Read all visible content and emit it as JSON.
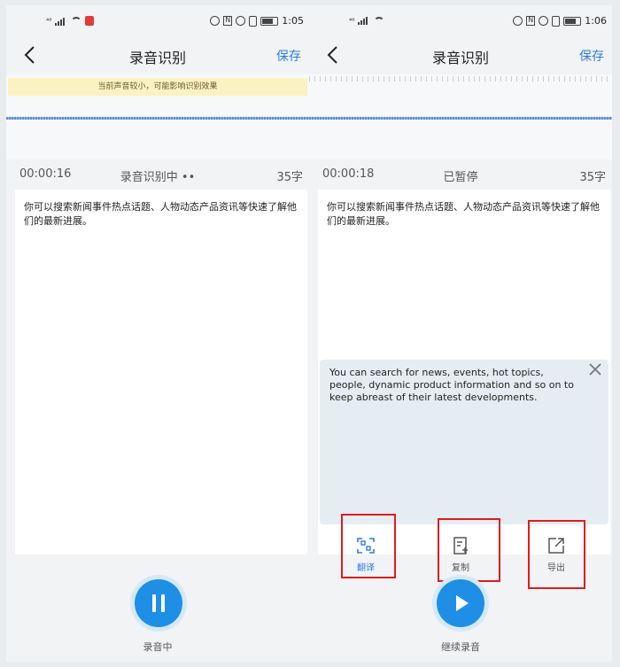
{
  "colors": {
    "accent": "#2a7de1",
    "button": "#1f8fe6",
    "highlight_box": "#e01c1c",
    "notice_bg": "#fbf2c2"
  },
  "left": {
    "status": {
      "time": "1:05",
      "carrier_label": "⁴⁶"
    },
    "nav": {
      "title": "录音识别",
      "save": "保存"
    },
    "notice": "当前声音较小，可能影响识别效果",
    "info": {
      "elapsed": "00:00:16",
      "state": "录音识别中 ••",
      "count": "35字"
    },
    "transcript": "你可以搜索新闻事件热点话题、人物动态产品资讯等快速了解他们的最新进展。",
    "bottom": {
      "label": "录音中",
      "icon": "pause-icon"
    }
  },
  "right": {
    "status": {
      "time": "1:06",
      "carrier_label": "⁴⁶"
    },
    "nav": {
      "title": "录音识别",
      "save": "保存"
    },
    "info": {
      "elapsed": "00:00:18",
      "state": "已暂停",
      "count": "35字"
    },
    "transcript": "你可以搜索新闻事件热点话题、人物动态产品资讯等快速了解他们的最新进展。",
    "translation": "You can search for news, events, hot topics, people, dynamic product information and so on to keep abreast of their latest developments.",
    "actions": [
      {
        "label": "翻译",
        "icon": "translate-icon",
        "active": true
      },
      {
        "label": "复制",
        "icon": "copy-icon",
        "active": false
      },
      {
        "label": "导出",
        "icon": "export-icon",
        "active": false
      }
    ],
    "bottom": {
      "label": "继续录音",
      "icon": "play-icon"
    }
  }
}
